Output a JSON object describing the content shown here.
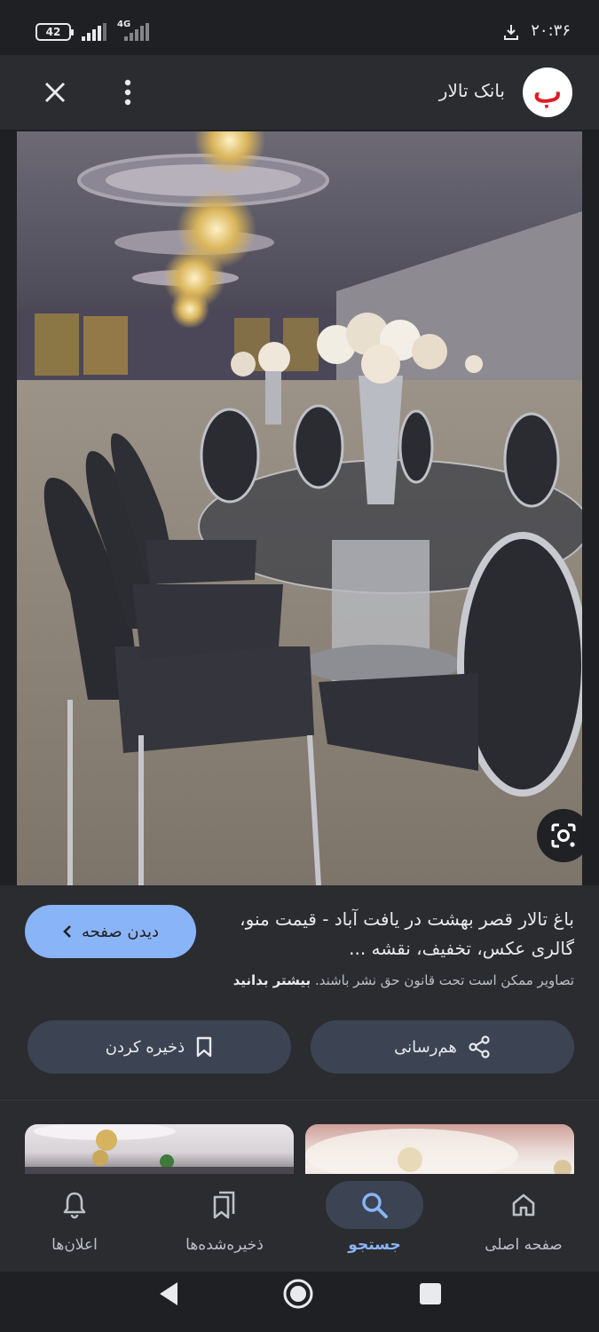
{
  "status_bar": {
    "battery": "42",
    "network": "4G",
    "time": "۲۰:۳۶"
  },
  "top_bar": {
    "site_logo_letter": "ب",
    "site_name": "بانک تالار",
    "icons": [
      "close-icon",
      "more-vert-icon"
    ]
  },
  "result": {
    "title": "باغ تالار قصر بهشت در یافت آباد - قیمت منو، گالری عکس، تخفیف، نقشه ...",
    "visit_button": "دیدن صفحه",
    "copyright_text": "تصاویر ممکن است تحت قانون حق نشر باشند.",
    "copyright_link": "بیشتر بدانید",
    "share_button": "هم‌رسانی",
    "save_button": "ذخیره کردن"
  },
  "bottom_nav": {
    "items": [
      {
        "label": "صفحه اصلی",
        "icon": "home-icon",
        "active": false
      },
      {
        "label": "جستجو",
        "icon": "search-icon",
        "active": true
      },
      {
        "label": "ذخیره‌شده‌ها",
        "icon": "bookmarks-icon",
        "active": false
      },
      {
        "label": "اعلان‌ها",
        "icon": "bell-icon",
        "active": false
      }
    ]
  },
  "colors": {
    "accent": "#8ab4f8",
    "surface": "#2b2c30",
    "button": "#3c4352"
  }
}
